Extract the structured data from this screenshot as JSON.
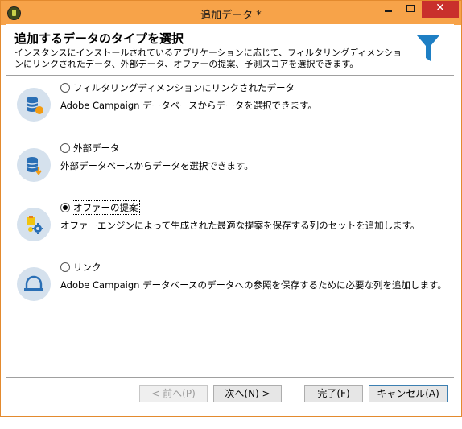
{
  "window": {
    "title": "追加データ *",
    "close_glyph": "✕"
  },
  "header": {
    "title": "追加するデータのタイプを選択",
    "description": "インスタンスにインストールされているアプリケーションに応じて、フィルタリングディメンションにリンクされたデータ、外部データ、オファーの提案、予測スコアを選択できます。",
    "icon": "funnel-icon",
    "icon_color": "#1e7fc4"
  },
  "options": [
    {
      "label": "フィルタリングディメンションにリンクされたデータ",
      "description": "Adobe Campaign データベースからデータを選択できます。",
      "icon": "database-orange-dot-icon",
      "selected": false
    },
    {
      "label": "外部データ",
      "description": "外部データベースからデータを選択できます。",
      "icon": "database-download-icon",
      "selected": false
    },
    {
      "label": "オファーの提案",
      "description": "オファーエンジンによって生成された最適な提案を保存する列のセットを追加します。",
      "icon": "offer-gear-icon",
      "selected": true
    },
    {
      "label": "リンク",
      "description": "Adobe Campaign データベースのデータへの参照を保存するために必要な列を追加します。",
      "icon": "link-arch-icon",
      "selected": false
    }
  ],
  "buttons": {
    "back": {
      "label": "< 前へ(",
      "key": "P",
      "tail": ")"
    },
    "next": {
      "label": "次へ(",
      "key": "N",
      "tail": ") >"
    },
    "finish": {
      "label": "完了(",
      "key": "F",
      "tail": ")"
    },
    "cancel": {
      "label": "キャンセル(",
      "key": "A",
      "tail": ")"
    }
  }
}
